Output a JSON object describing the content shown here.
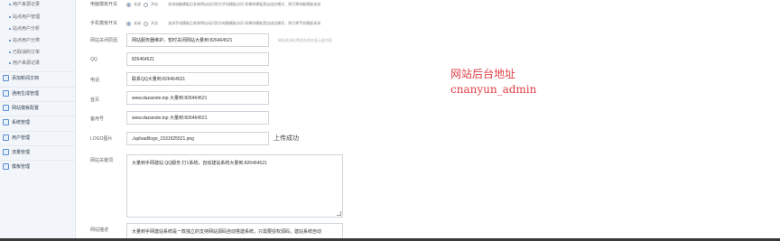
{
  "sidebar": {
    "sub_items": [
      {
        "label": "用户来源记录"
      },
      {
        "label": "站点用户管理"
      },
      {
        "label": "站点用户分析"
      },
      {
        "label": "站点用户分类"
      },
      {
        "label": "已取消的订单"
      },
      {
        "label": "用户来源记录"
      }
    ],
    "main_items": [
      {
        "label": "添加新闻文档"
      },
      {
        "label": "通用生成管理"
      },
      {
        "label": "网站模板配置"
      },
      {
        "label": "系统管理"
      },
      {
        "label": "用户管理"
      },
      {
        "label": "流量管理"
      },
      {
        "label": "模板管理"
      }
    ]
  },
  "form": {
    "pc_mode": {
      "label": "电脑模板开关",
      "opt_on": "关闭",
      "opt_off": "开启",
      "hint": "关闭电脑模板后系统将自动识别为手机模板访问 如果你模板是自适应模式，则可将电脑模板关闭"
    },
    "mobile_mode": {
      "label": "手机模板开关",
      "opt_on": "关闭",
      "opt_off": "开启",
      "hint": "关闭手机模板后系统将自动识别为电脑模板访问 如果你模板是自适应模式，则可将手机模板关闭"
    },
    "close_reason": {
      "label": "网站关闭原因",
      "value": "网站服务器维护，暂时关闭网站大量到:826464521",
      "hint": "网站关闭后将会在前台显示此内容"
    },
    "qq": {
      "label": "QQ",
      "value": "826464521"
    },
    "phone": {
      "label": "电话",
      "value": "联系QQ大量到:826464521"
    },
    "homepage": {
      "label": "首页",
      "value": "www.dazanole.top 大量到:826464521"
    },
    "backup": {
      "label": "备用号",
      "value": "www.dazanole.top 大量到:826464521"
    },
    "logo": {
      "label": "LOGO图片",
      "value": "./upload/logo_1531925521.png",
      "upload_status": "上传成功"
    },
    "keywords": {
      "label": "网站关键词",
      "value": "大量到手网建站 QQ服务 打1系统，自动建站系统大量到:826464521"
    },
    "description": {
      "label": "网站描述",
      "value": "大量到手网建站系统是一款独立的支持网站源码自动搭建系统，只需要授权源码，建站系统自动"
    }
  },
  "overlay": {
    "line1": "网站后台地址",
    "line2": "cnanyun_admin"
  }
}
